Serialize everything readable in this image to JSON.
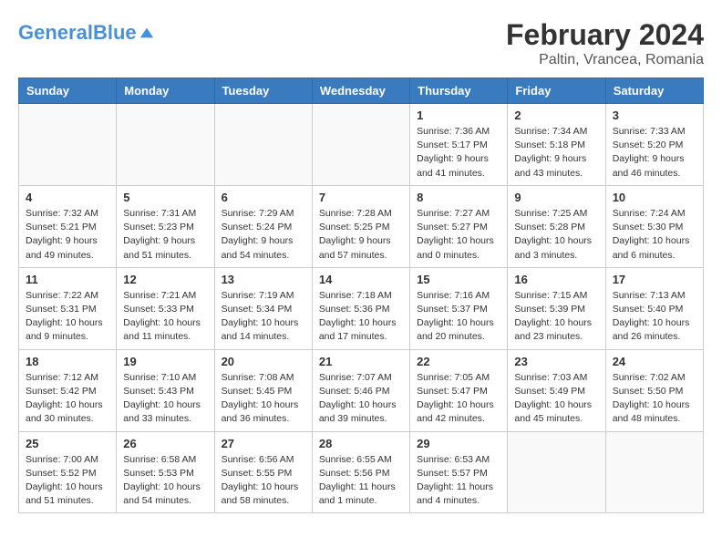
{
  "header": {
    "logo_general": "General",
    "logo_blue": "Blue",
    "month_year": "February 2024",
    "location": "Paltin, Vrancea, Romania"
  },
  "days_of_week": [
    "Sunday",
    "Monday",
    "Tuesday",
    "Wednesday",
    "Thursday",
    "Friday",
    "Saturday"
  ],
  "weeks": [
    [
      {
        "day": "",
        "info": ""
      },
      {
        "day": "",
        "info": ""
      },
      {
        "day": "",
        "info": ""
      },
      {
        "day": "",
        "info": ""
      },
      {
        "day": "1",
        "info": "Sunrise: 7:36 AM\nSunset: 5:17 PM\nDaylight: 9 hours\nand 41 minutes."
      },
      {
        "day": "2",
        "info": "Sunrise: 7:34 AM\nSunset: 5:18 PM\nDaylight: 9 hours\nand 43 minutes."
      },
      {
        "day": "3",
        "info": "Sunrise: 7:33 AM\nSunset: 5:20 PM\nDaylight: 9 hours\nand 46 minutes."
      }
    ],
    [
      {
        "day": "4",
        "info": "Sunrise: 7:32 AM\nSunset: 5:21 PM\nDaylight: 9 hours\nand 49 minutes."
      },
      {
        "day": "5",
        "info": "Sunrise: 7:31 AM\nSunset: 5:23 PM\nDaylight: 9 hours\nand 51 minutes."
      },
      {
        "day": "6",
        "info": "Sunrise: 7:29 AM\nSunset: 5:24 PM\nDaylight: 9 hours\nand 54 minutes."
      },
      {
        "day": "7",
        "info": "Sunrise: 7:28 AM\nSunset: 5:25 PM\nDaylight: 9 hours\nand 57 minutes."
      },
      {
        "day": "8",
        "info": "Sunrise: 7:27 AM\nSunset: 5:27 PM\nDaylight: 10 hours\nand 0 minutes."
      },
      {
        "day": "9",
        "info": "Sunrise: 7:25 AM\nSunset: 5:28 PM\nDaylight: 10 hours\nand 3 minutes."
      },
      {
        "day": "10",
        "info": "Sunrise: 7:24 AM\nSunset: 5:30 PM\nDaylight: 10 hours\nand 6 minutes."
      }
    ],
    [
      {
        "day": "11",
        "info": "Sunrise: 7:22 AM\nSunset: 5:31 PM\nDaylight: 10 hours\nand 9 minutes."
      },
      {
        "day": "12",
        "info": "Sunrise: 7:21 AM\nSunset: 5:33 PM\nDaylight: 10 hours\nand 11 minutes."
      },
      {
        "day": "13",
        "info": "Sunrise: 7:19 AM\nSunset: 5:34 PM\nDaylight: 10 hours\nand 14 minutes."
      },
      {
        "day": "14",
        "info": "Sunrise: 7:18 AM\nSunset: 5:36 PM\nDaylight: 10 hours\nand 17 minutes."
      },
      {
        "day": "15",
        "info": "Sunrise: 7:16 AM\nSunset: 5:37 PM\nDaylight: 10 hours\nand 20 minutes."
      },
      {
        "day": "16",
        "info": "Sunrise: 7:15 AM\nSunset: 5:39 PM\nDaylight: 10 hours\nand 23 minutes."
      },
      {
        "day": "17",
        "info": "Sunrise: 7:13 AM\nSunset: 5:40 PM\nDaylight: 10 hours\nand 26 minutes."
      }
    ],
    [
      {
        "day": "18",
        "info": "Sunrise: 7:12 AM\nSunset: 5:42 PM\nDaylight: 10 hours\nand 30 minutes."
      },
      {
        "day": "19",
        "info": "Sunrise: 7:10 AM\nSunset: 5:43 PM\nDaylight: 10 hours\nand 33 minutes."
      },
      {
        "day": "20",
        "info": "Sunrise: 7:08 AM\nSunset: 5:45 PM\nDaylight: 10 hours\nand 36 minutes."
      },
      {
        "day": "21",
        "info": "Sunrise: 7:07 AM\nSunset: 5:46 PM\nDaylight: 10 hours\nand 39 minutes."
      },
      {
        "day": "22",
        "info": "Sunrise: 7:05 AM\nSunset: 5:47 PM\nDaylight: 10 hours\nand 42 minutes."
      },
      {
        "day": "23",
        "info": "Sunrise: 7:03 AM\nSunset: 5:49 PM\nDaylight: 10 hours\nand 45 minutes."
      },
      {
        "day": "24",
        "info": "Sunrise: 7:02 AM\nSunset: 5:50 PM\nDaylight: 10 hours\nand 48 minutes."
      }
    ],
    [
      {
        "day": "25",
        "info": "Sunrise: 7:00 AM\nSunset: 5:52 PM\nDaylight: 10 hours\nand 51 minutes."
      },
      {
        "day": "26",
        "info": "Sunrise: 6:58 AM\nSunset: 5:53 PM\nDaylight: 10 hours\nand 54 minutes."
      },
      {
        "day": "27",
        "info": "Sunrise: 6:56 AM\nSunset: 5:55 PM\nDaylight: 10 hours\nand 58 minutes."
      },
      {
        "day": "28",
        "info": "Sunrise: 6:55 AM\nSunset: 5:56 PM\nDaylight: 11 hours\nand 1 minute."
      },
      {
        "day": "29",
        "info": "Sunrise: 6:53 AM\nSunset: 5:57 PM\nDaylight: 11 hours\nand 4 minutes."
      },
      {
        "day": "",
        "info": ""
      },
      {
        "day": "",
        "info": ""
      }
    ]
  ]
}
